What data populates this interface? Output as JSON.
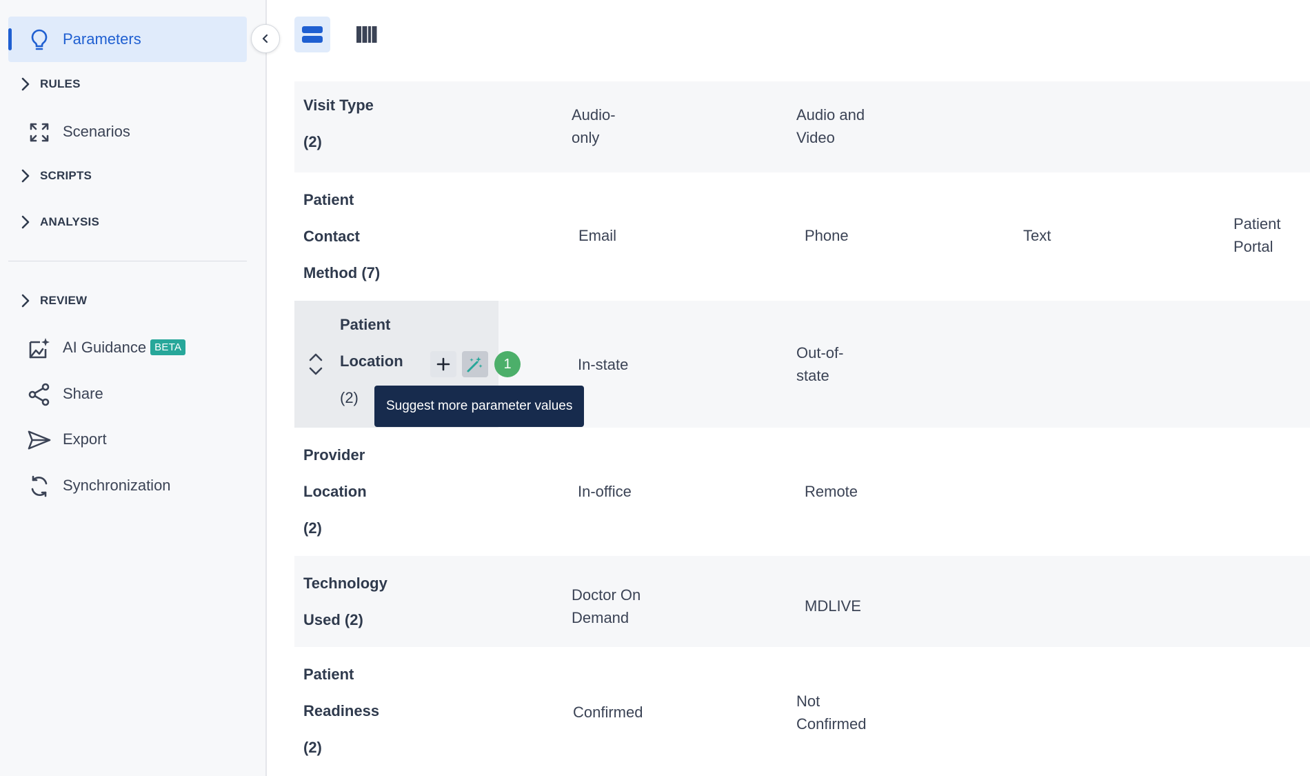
{
  "sidebar": {
    "items": [
      {
        "label": "Parameters",
        "icon": "lightbulb-icon",
        "active": true
      },
      {
        "label": "Scenarios",
        "icon": "expand-arrows-icon"
      },
      {
        "label": "AI Guidance",
        "icon": "ai-guidance-icon",
        "badge": "BETA"
      },
      {
        "label": "Share",
        "icon": "share-icon"
      },
      {
        "label": "Export",
        "icon": "send-icon"
      },
      {
        "label": "Synchronization",
        "icon": "sync-icon"
      }
    ],
    "sections": {
      "rules": "RULES",
      "scripts": "SCRIPTS",
      "analysis": "ANALYSIS",
      "review": "REVIEW"
    }
  },
  "toolbar": {
    "views": [
      {
        "icon": "rows-view-icon",
        "active": true
      },
      {
        "icon": "columns-view-icon",
        "active": false
      }
    ]
  },
  "parameters": [
    {
      "name_lines": [
        "Visit Type",
        "(2)"
      ],
      "values": [
        "Audio-\nonly",
        "Audio and\nVideo"
      ]
    },
    {
      "name_lines": [
        "Patient",
        "Contact",
        "Method (7)"
      ],
      "values": [
        "Email",
        "Phone",
        "Text",
        "Patient\nPortal"
      ]
    },
    {
      "name_lines": [
        "Patient",
        "Location",
        "(2)"
      ],
      "values": [
        "In-state",
        "Out-of-\nstate"
      ],
      "selected": true,
      "suggestion_count": "1"
    },
    {
      "name_lines": [
        "Provider",
        "Location",
        "(2)"
      ],
      "values": [
        "In-office",
        "Remote"
      ]
    },
    {
      "name_lines": [
        "Technology",
        "Used (2)"
      ],
      "values": [
        "Doctor On\nDemand",
        "MDLIVE"
      ]
    },
    {
      "name_lines": [
        "Patient",
        "Readiness",
        "(2)"
      ],
      "values": [
        "Confirmed",
        "Not\nConfirmed"
      ]
    }
  ],
  "tooltip": {
    "text": "Suggest more parameter values"
  },
  "colors": {
    "accent": "#1f5fd1",
    "active_bg": "#e0ebfb",
    "beta_badge": "#27a79a",
    "count_badge": "#4caf6a",
    "tooltip_bg": "#172b4d"
  }
}
